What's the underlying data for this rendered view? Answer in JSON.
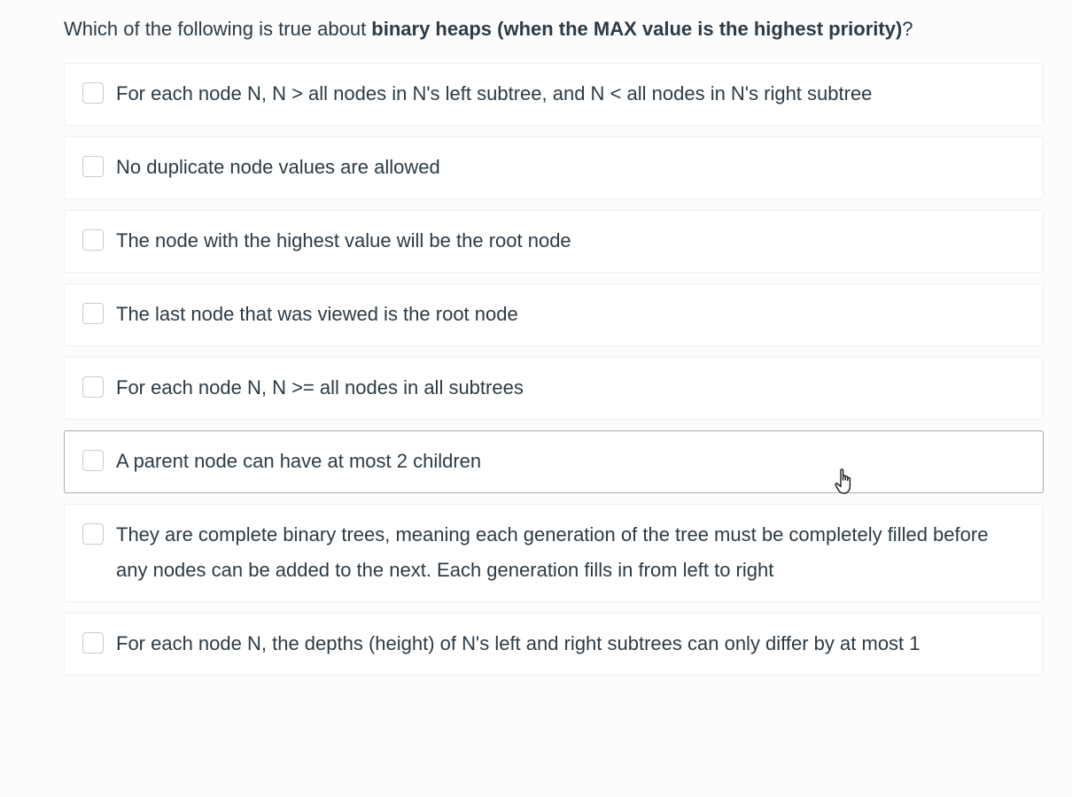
{
  "question": {
    "prefix": "Which of the following is true about ",
    "bold": "binary heaps (when the MAX value is the highest priority)",
    "suffix": "?"
  },
  "answers": [
    {
      "label": "For each node N, N > all nodes in N's left subtree, and N < all nodes in N's right subtree",
      "checked": false
    },
    {
      "label": "No duplicate node values are allowed",
      "checked": false
    },
    {
      "label": "The node with the highest value will be the root node",
      "checked": false
    },
    {
      "label": "The last node that was viewed is the root node",
      "checked": false
    },
    {
      "label": "For each node N, N >= all nodes in all subtrees",
      "checked": false
    },
    {
      "label": "A parent node can have at most 2 children",
      "checked": false,
      "hovered": true
    },
    {
      "label": "They are complete binary trees, meaning each generation of the tree must be completely filled before any nodes can be added to the next. Each generation fills in from left to right",
      "checked": false
    },
    {
      "label": "For each node N, the depths (height) of N's left and right subtrees can only differ by at most 1",
      "checked": false
    }
  ],
  "icons": {
    "cursor": "hand-pointer-icon"
  },
  "colors": {
    "text": "#2d3b45",
    "border": "#eef0f2",
    "hover_border": "#a7adb3"
  }
}
